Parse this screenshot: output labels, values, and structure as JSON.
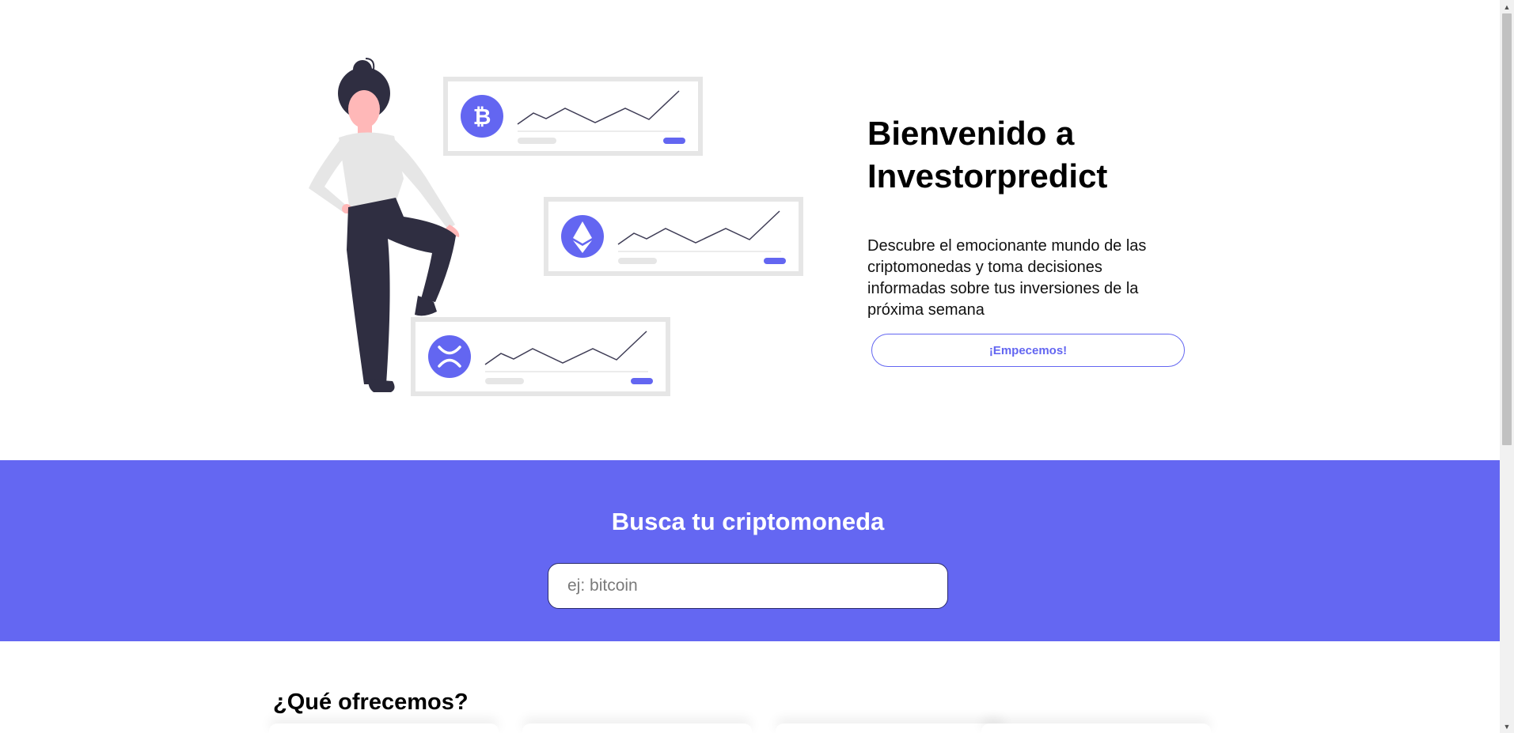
{
  "hero": {
    "title_line1": "Bienvenido a",
    "title_line2": "Investorpredict",
    "description": "Descubre el emocionante mundo de las criptomonedas y toma decisiones informadas sobre tus inversiones de la próxima semana",
    "cta_label": "¡Empecemos!",
    "illustration": {
      "cards": [
        {
          "coin_icon": "bitcoin-icon"
        },
        {
          "coin_icon": "ethereum-icon"
        },
        {
          "coin_icon": "xrp-icon"
        }
      ],
      "accent_color": "#6366f1"
    }
  },
  "search": {
    "title": "Busca tu criptomoneda",
    "placeholder": "ej: bitcoin",
    "value": "",
    "background_color": "#6467f2"
  },
  "offer": {
    "title": "¿Qué ofrecemos?"
  },
  "theme": {
    "accent": "#6366f1",
    "text": "#111111",
    "background": "#ffffff"
  }
}
